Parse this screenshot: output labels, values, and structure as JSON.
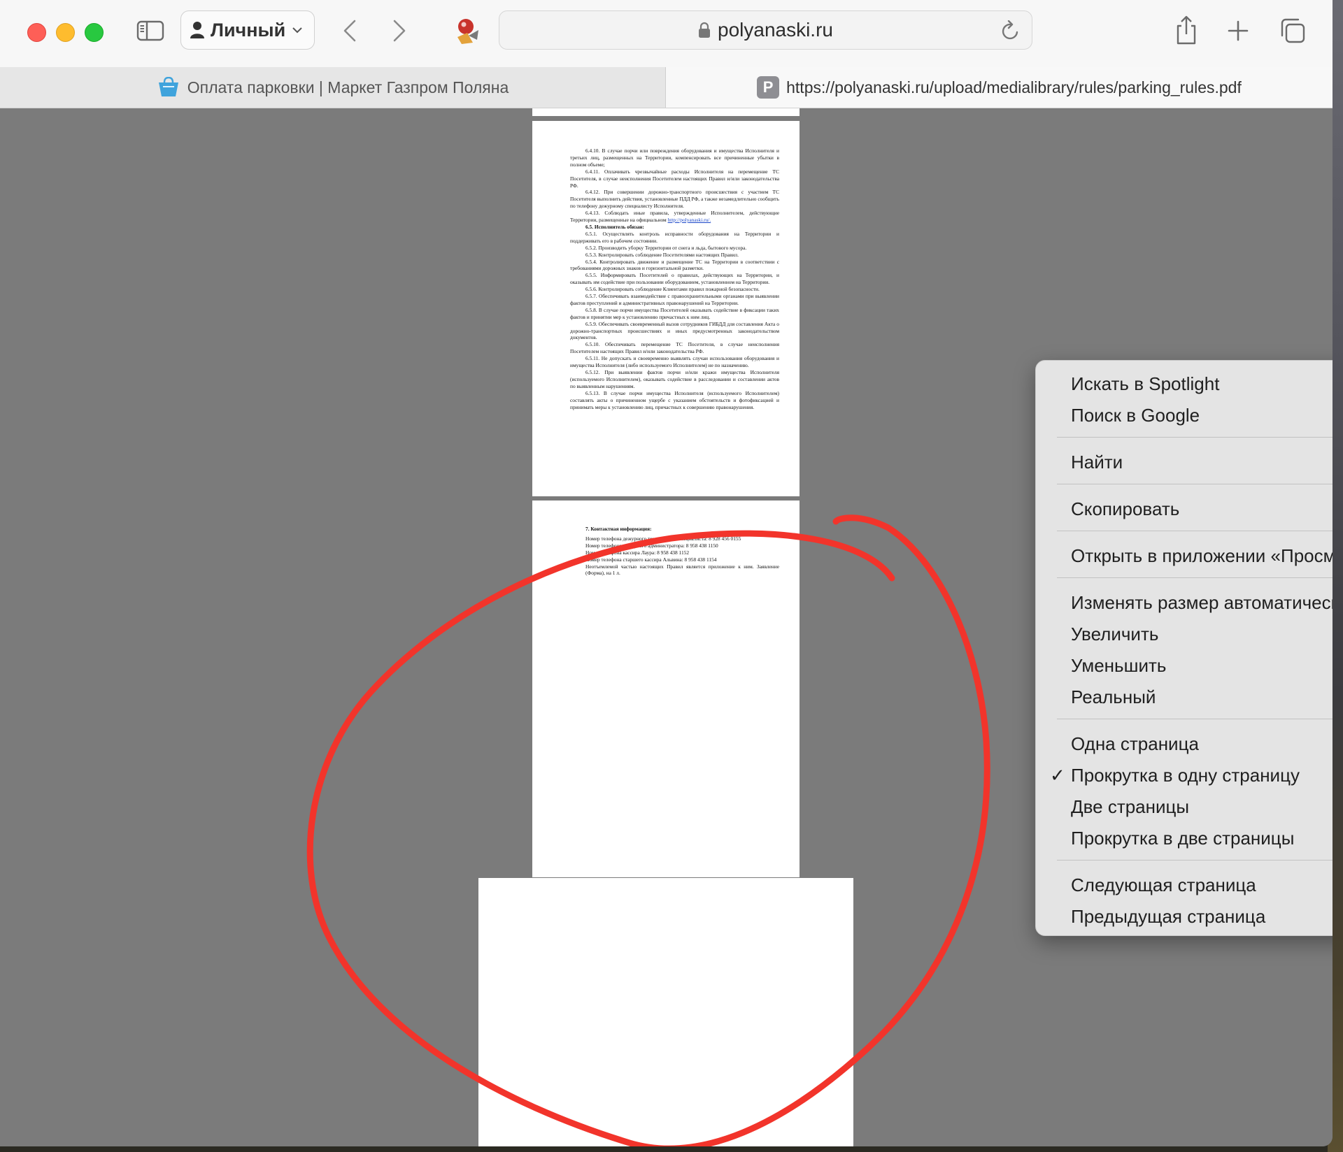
{
  "browser": {
    "profile_label": "Личный",
    "address_domain": "polyanaski.ru",
    "icons": {
      "sidebar": "sidebar-icon",
      "profile": "person-icon",
      "back": "chevron-left-icon",
      "forward": "chevron-right-icon",
      "extension": "extension-icon",
      "lock": "lock-icon",
      "reload": "reload-icon",
      "share": "share-icon",
      "new_tab": "plus-icon",
      "tab_overview": "tab-overview-icon"
    }
  },
  "tabs": [
    {
      "title": "Оплата парковки | Маркет Газпром Поляна",
      "icon": "bag-favicon",
      "active": false
    },
    {
      "title": "https://polyanaski.ru/upload/medialibrary/rules/parking_rules.pdf",
      "badge": "P",
      "active": true
    }
  ],
  "pdf": {
    "page1_paragraphs": [
      "6.4.10.    В случае порчи или повреждения оборудования и имущества Исполнителя и третьих лиц, размещенных на Территории, компенсировать все причиненные убытки в полном объеме;",
      "6.4.11.    Оплачивать чрезвычайные расходы Исполнителя на перемещение ТС Посетителя, в случае неисполнения Посетителем настоящих Правил и/или законодательства РФ.",
      "6.4.12.    При совершении дорожно-транспортного происшествия с участием ТС Посетителя выполнить действия, установленные ПДД РФ, а также незамедлительно сообщить по телефону дежурному специалисту Исполнителя.",
      "6.4.13.    Соблюдать иные правила, утвержденные Исполнителем, действующие Территории, размещенные на официальном",
      "6.5.1. Осуществлять контроль исправности оборудования на Территории и поддерживать его в рабочем состоянии.",
      "6.5.2. Производить уборку Территории от снега и льда, бытового мусора.",
      "6.5.3. Контролировать соблюдение Посетителями настоящих Правил.",
      "6.5.4. Контролировать движение и размещение ТС на Территории в соответствии с требованиями дорожных знаков и горизонтальной разметки.",
      "6.5.5. Информировать Посетителей о правилах, действующих на Территории, и оказывать им содействие при пользовании оборудованием, установленном на Территории.",
      "6.5.6. Контролировать соблюдение Клиентами правил пожарной безопасности.",
      "6.5.7. Обеспечивать взаимодействие с правоохранительными органами при выявлении фактов преступлений и административных правонарушений на Территории.",
      "6.5.8. В случае порчи имущества Посетителей оказывать содействие в фиксации таких фактов и принятии мер к установлению причастных к ним лиц.",
      "6.5.9. Обеспечивать своевременный вызов сотрудников ГИБДД для составления Акта о дорожно-транспортных происшествиях и иных предусмотренных законодательством документов.",
      "6.5.10. Обеспечивать перемещение ТС Посетителя, в случае неисполнения Посетителем настоящих Правил и/или законодательства РФ.",
      "6.5.11. Не допускать и своевременно выявлять случаи использования оборудования и имущества Исполнителя (либо используемого Исполнителем) не по назначению.",
      "6.5.12. При выявлении фактов порчи и/или кражи имущества Исполнителя (используемого Исполнителем), оказывать содействие в расследовании и составлении актов по выявленным нарушениям.",
      "6.5.13. В случае порчи имущества Исполнителя (используемого Исполнителем) составлять акты о причиненном ущербе с указанием обстоятельств и фотофиксацией и принимать меры к установлению лиц, причастных к совершению правонарушения."
    ],
    "page1_link": "http://polyanaski.ru/.",
    "page1_heading": "6.5.  Исполнитель обязан:",
    "page2_title": "7.  Контактная информация:",
    "page2_lines": [
      "Номер телефона дежурного технического специалиста: 8 928 456 0155",
      "Номер телефона дежурного администратора: 8 958 438 1150",
      "Номер телефона кассира Лаура: 8 958 438 1152",
      "Номер телефона старшего кассира Альвина: 8 958 438 1154",
      "",
      "Неотъемлемой частью настоящих Правил является приложение к ним. Заявление (Форма), на 1 л."
    ]
  },
  "annotation": {
    "color": "#f2342b",
    "shape": "hand-drawn-circle"
  },
  "context_menu": {
    "groups": [
      [
        "Искать в Spotlight",
        "Поиск в Google"
      ],
      [
        "Найти"
      ],
      [
        "Скопировать"
      ],
      [
        "Открыть в приложении «Просмотр»"
      ],
      [
        "Изменять размер автоматически",
        "Увеличить",
        "Уменьшить",
        "Реальный"
      ],
      [
        "Одна страница",
        "Прокрутка в одну страницу",
        "Две страницы",
        "Прокрутка в две страницы"
      ],
      [
        "Следующая страница",
        "Предыдущая страница"
      ]
    ],
    "checked_item": "Прокрутка в одну страницу",
    "checkmark": "✓"
  }
}
